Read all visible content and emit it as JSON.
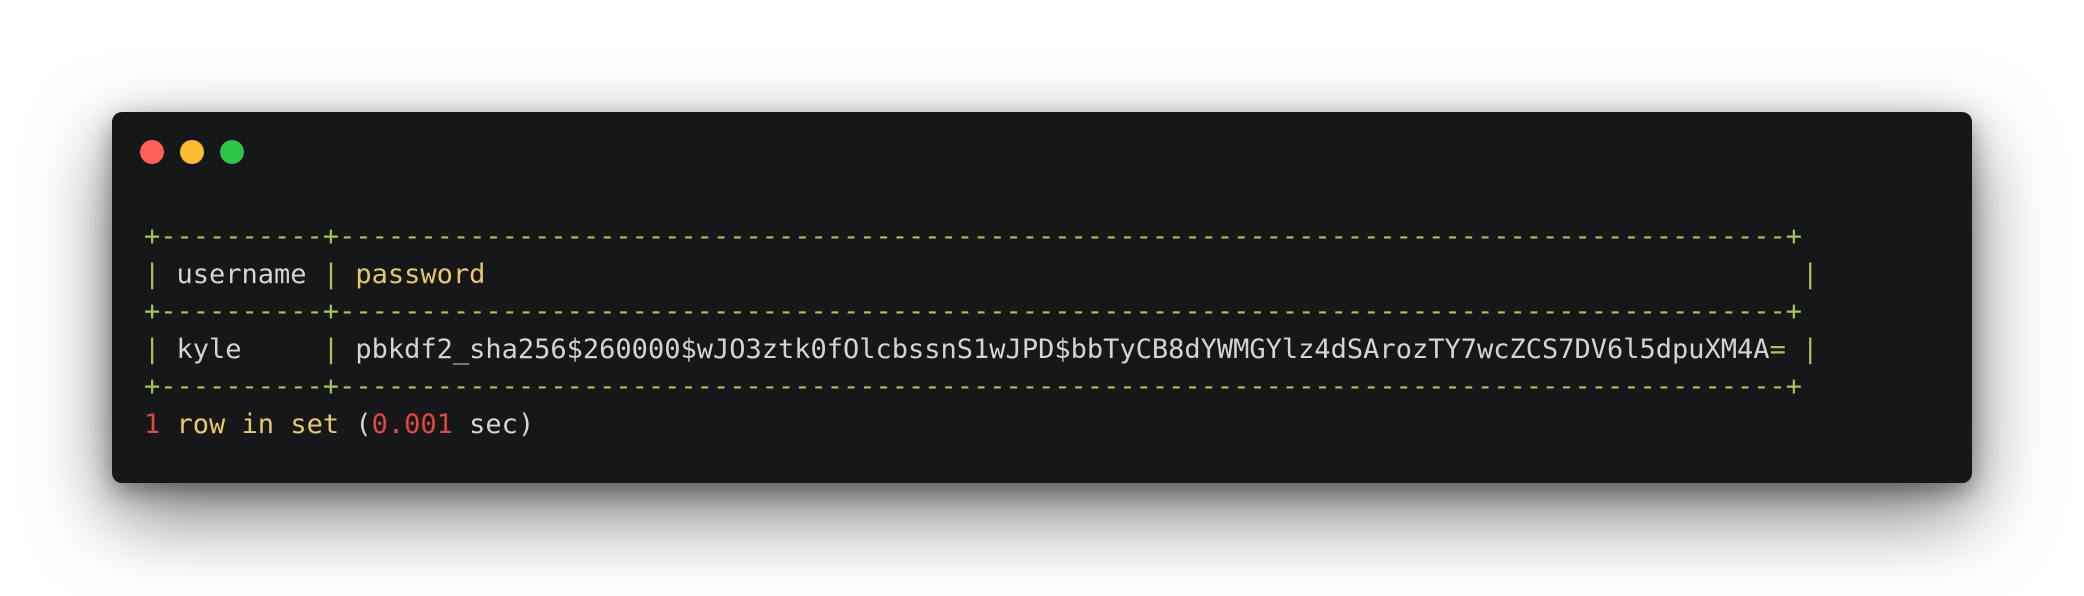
{
  "window": {
    "traffic_lights": [
      {
        "name": "close",
        "color": "#ff5f57"
      },
      {
        "name": "minimize",
        "color": "#febc2e"
      },
      {
        "name": "maximize",
        "color": "#28c840"
      }
    ],
    "background": "#161719"
  },
  "table": {
    "border_top": "+----------+-----------------------------------------------------------------------------------------+",
    "columns": [
      "username",
      "password"
    ],
    "border_mid": "+----------+-----------------------------------------------------------------------------------------+",
    "rows": [
      {
        "username": "kyle",
        "password": "pbkdf2_sha256$260000$wJO3ztk0fOlcbssnS1wJPD$bbTyCB8dYWMGYlz4dSArozTY7wcZCS7DV6l5dpuXM4A"
      }
    ],
    "password_suffix": "=",
    "border_bottom": "+----------+-----------------------------------------------------------------------------------------+"
  },
  "result": {
    "count": "1",
    "text": "row in set",
    "time": "0.001",
    "unit": "sec"
  },
  "colors": {
    "border": "#a6c25a",
    "keyword": "#e8c86a",
    "number": "#e0483f",
    "text": "#d4d4d4"
  }
}
